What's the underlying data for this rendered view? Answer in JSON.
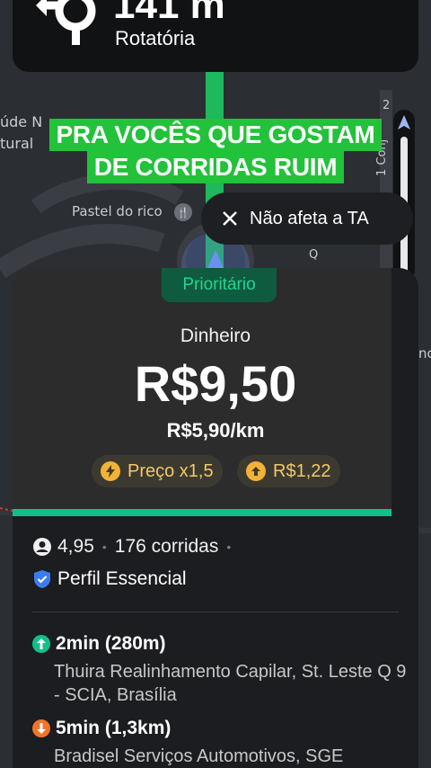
{
  "nav": {
    "distance": "141 m",
    "street": "Rotatória",
    "maneuver_icon": "roundabout-icon"
  },
  "map": {
    "labels": [
      "úde N",
      "tural",
      "Pastel do rico",
      "1 Conj",
      "2",
      "Q",
      "no"
    ]
  },
  "caption": {
    "line1": "PRA VOCÊS QUE GOSTAM",
    "line2": "DE CORRIDAS RUIM"
  },
  "dismiss": {
    "label": "Não afeta a TA"
  },
  "card": {
    "badge": "Prioritário",
    "payment": "Dinheiro",
    "price": "R$9,50",
    "per_km": "R$5,90/km",
    "chips": [
      {
        "icon": "lightning-icon",
        "label": "Preço x1,5"
      },
      {
        "icon": "arrow-up-icon",
        "label": "R$1,22"
      }
    ],
    "rating": "4,95",
    "rides": "176 corridas",
    "profile": "Perfil Essencial",
    "pickup": {
      "eta": "2min (280m)",
      "address": "Thuira Realinhamento Capilar, St. Leste Q 9 - SCIA, Brasília"
    },
    "dropoff": {
      "eta": "5min (1,3km)",
      "address": "Bradisel Serviços Automotivos, SGE"
    }
  },
  "colors": {
    "accent_green": "#12bf8a",
    "caption_green": "#22c23a",
    "chip_text": "#f2c86a",
    "pickup_green": "#12bf8a",
    "dropoff_orange": "#f0752a",
    "shield_blue": "#3d7bf0"
  }
}
